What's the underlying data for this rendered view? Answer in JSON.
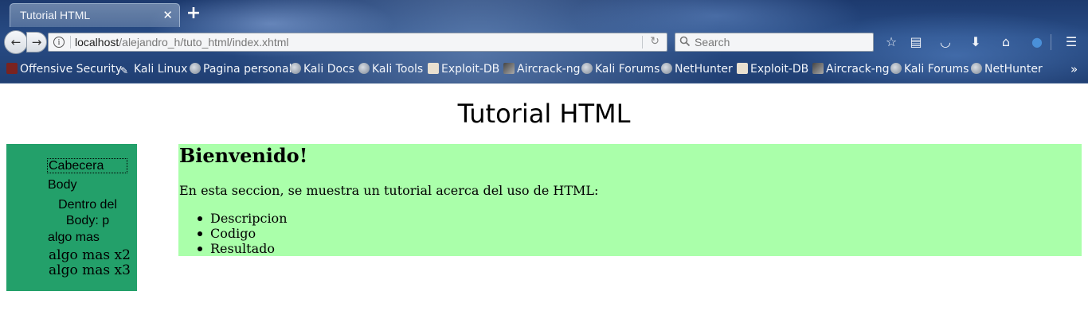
{
  "browser": {
    "tab_title": "Tutorial HTML",
    "tab_close_icon": "close-icon",
    "new_tab_icon": "plus-icon",
    "url_host": "localhost",
    "url_path": "/alejandro_h/tuto_html/index.xhtml",
    "search_placeholder": "Search",
    "toolbar_icons": [
      "star-icon",
      "reader-icon",
      "pocket-icon",
      "download-icon",
      "home-icon",
      "account-icon",
      "menu-icon"
    ]
  },
  "bookmarks": [
    {
      "label": "Offensive Security",
      "icon": "offsec-icon"
    },
    {
      "label": "Kali Linux",
      "icon": "kali-icon"
    },
    {
      "label": "Pagina personal",
      "icon": "globe-icon"
    },
    {
      "label": "Kali Docs",
      "icon": "globe-icon"
    },
    {
      "label": "Kali Tools",
      "icon": "globe-icon"
    },
    {
      "label": "Exploit-DB",
      "icon": "exploitdb-icon"
    },
    {
      "label": "Aircrack-ng",
      "icon": "aircrack-icon"
    },
    {
      "label": "Kali Forums",
      "icon": "globe-icon"
    },
    {
      "label": "NetHunter",
      "icon": "globe-icon"
    },
    {
      "label": "Exploit-DB",
      "icon": "exploitdb-icon"
    },
    {
      "label": "Aircrack-ng",
      "icon": "aircrack-icon"
    },
    {
      "label": "Kali Forums",
      "icon": "globe-icon"
    },
    {
      "label": "NetHunter",
      "icon": "globe-icon"
    }
  ],
  "page": {
    "title": "Tutorial HTML",
    "sidebar": {
      "cabecera": "Cabecera",
      "body": "Body",
      "dentro": "Dentro del Body: p",
      "algo_mas": "algo mas",
      "algo_mas_x2": "algo mas x2",
      "algo_mas_x3": "algo mas x3"
    },
    "main": {
      "heading": "Bienvenido!",
      "intro": "En esta seccion, se muestra un tutorial acerca del uso de HTML:",
      "items": [
        "Descripcion",
        "Codigo",
        "Resultado"
      ]
    }
  },
  "colors": {
    "sidebar_bg": "#23a06a",
    "main_bg": "#aaffaa"
  }
}
